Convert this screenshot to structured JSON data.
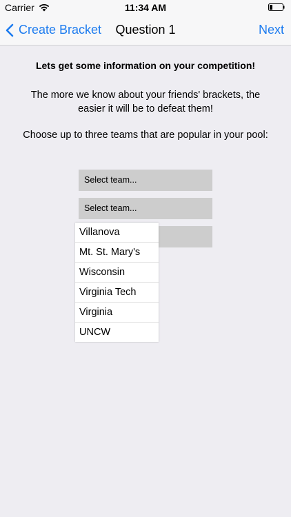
{
  "status_bar": {
    "carrier": "Carrier",
    "time": "11:34 AM"
  },
  "nav": {
    "back_label": "Create Bracket",
    "title": "Question 1",
    "next_label": "Next"
  },
  "content": {
    "heading": "Lets get some information on your competition!",
    "paragraph": "The more we know about your friends' brackets, the easier it will be to defeat them!",
    "instruction": "Choose up to three teams that are popular in your pool:"
  },
  "selects": [
    {
      "value": "Select team..."
    },
    {
      "value": "Select team..."
    },
    {
      "value": ""
    }
  ],
  "dropdown_options": [
    "Villanova",
    "Mt. St. Mary's",
    "Wisconsin",
    "Virginia Tech",
    "Virginia",
    "UNCW"
  ],
  "colors": {
    "accent": "#1c7bef",
    "background": "#eeedf2",
    "select_bg": "#cdcdcd"
  },
  "icons": [
    "wifi-icon",
    "battery-icon",
    "chevron-left-icon"
  ]
}
